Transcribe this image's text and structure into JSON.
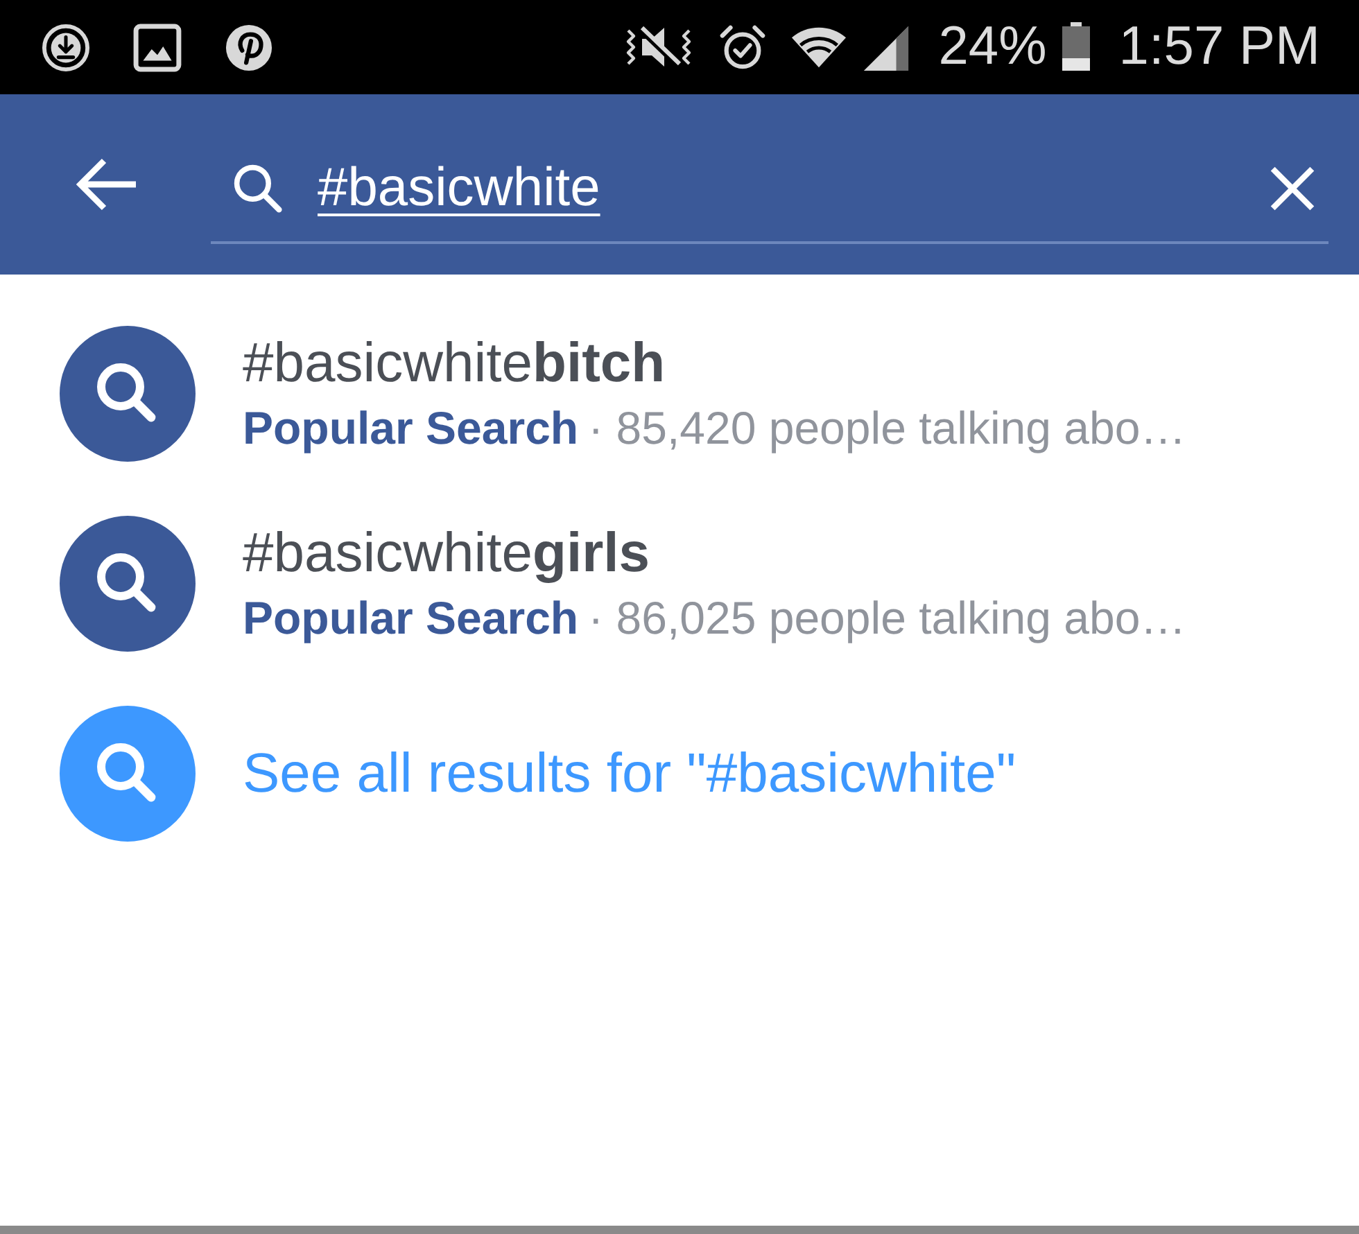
{
  "status_bar": {
    "battery": "24%",
    "time": "1:57 PM"
  },
  "search_bar": {
    "query": "#basicwhite"
  },
  "results": [
    {
      "kind": "suggestion",
      "title": "#basicwhite**bitch**",
      "category": "Popular Search",
      "detail": "· 85,420 people talking abo…"
    },
    {
      "kind": "suggestion",
      "title": "#basicwhite**girls**",
      "category": "Popular Search",
      "detail": "· 86,025 people talking abo…"
    },
    {
      "kind": "see_all",
      "title": "See all results for \"#basicwhite\""
    }
  ]
}
